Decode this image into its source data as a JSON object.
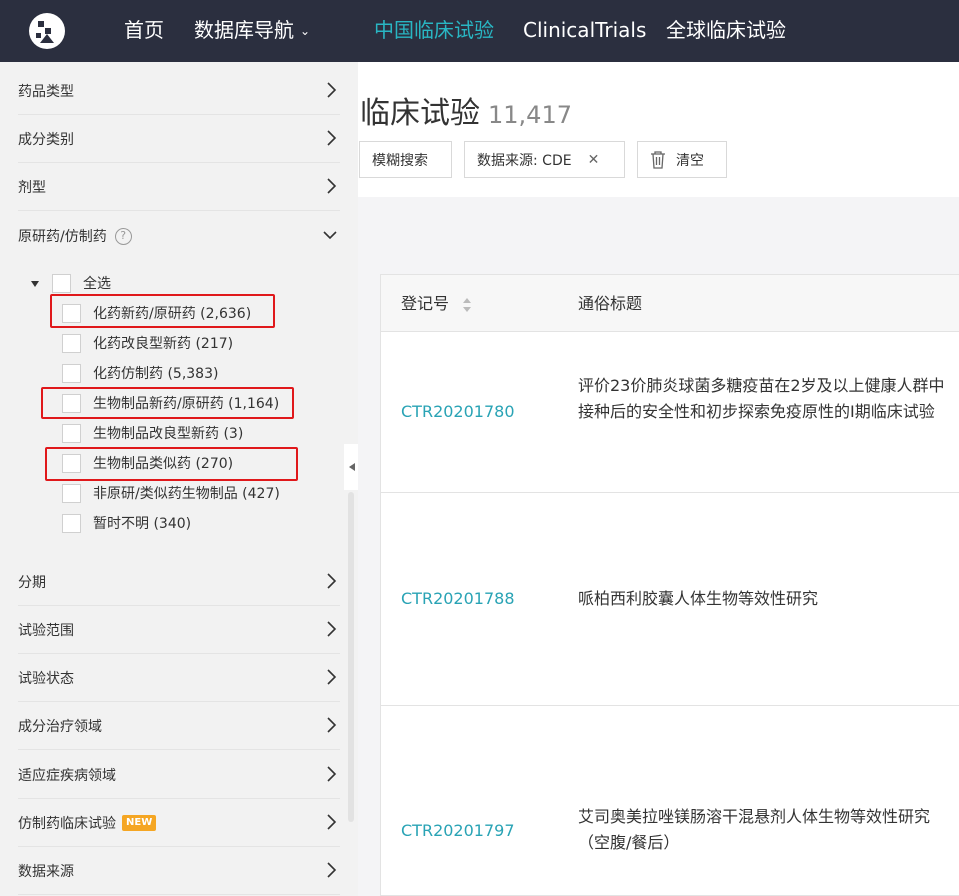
{
  "nav": {
    "items": [
      {
        "label": "首页"
      },
      {
        "label": "数据库导航"
      },
      {
        "label": "中国临床试验"
      },
      {
        "label": "ClinicalTrials"
      },
      {
        "label": "全球临床试验"
      }
    ]
  },
  "sidebar": {
    "filters_top": [
      {
        "label": "药品类型"
      },
      {
        "label": "成分类别"
      },
      {
        "label": "剂型"
      },
      {
        "label": "原研药/仿制药"
      }
    ],
    "tree": {
      "select_all": "全选",
      "options": [
        {
          "label": "化药新药/原研药 (2,636)"
        },
        {
          "label": "化药改良型新药 (217)"
        },
        {
          "label": "化药仿制药 (5,383)"
        },
        {
          "label": "生物制品新药/原研药 (1,164)"
        },
        {
          "label": "生物制品改良型新药 (3)"
        },
        {
          "label": "生物制品类似药 (270)"
        },
        {
          "label": "非原研/类似药生物制品 (427)"
        },
        {
          "label": "暂时不明 (340)"
        }
      ]
    },
    "filters_bottom": [
      {
        "label": "分期"
      },
      {
        "label": "试验范围"
      },
      {
        "label": "试验状态"
      },
      {
        "label": "成分治疗领域"
      },
      {
        "label": "适应症疾病领域"
      },
      {
        "label": "仿制药临床试验",
        "badge": "NEW"
      },
      {
        "label": "数据来源"
      }
    ]
  },
  "main": {
    "title": "临床试验",
    "count": "11,417",
    "buttons": {
      "fuzzy": "模糊搜索",
      "source": "数据来源: CDE",
      "clear": "清空"
    },
    "table": {
      "headers": [
        "登记号",
        "通俗标题"
      ],
      "rows": [
        {
          "id": "CTR20201780",
          "title": "评价23价肺炎球菌多糖疫苗在2岁及以上健康人群中接种后的安全性和初步探索免疫原性的Ⅰ期临床试验"
        },
        {
          "id": "CTR20201788",
          "title": "哌柏西利胶囊人体生物等效性研究"
        },
        {
          "id": "CTR20201797",
          "title": "艾司奥美拉唑镁肠溶干混悬剂人体生物等效性研究（空腹/餐后）"
        }
      ]
    }
  }
}
